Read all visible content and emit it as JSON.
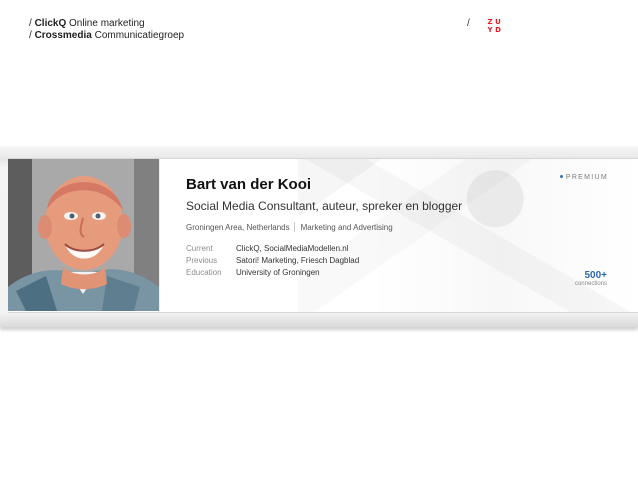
{
  "header": {
    "lines": [
      {
        "prefix": "/ ",
        "brand": "ClickQ",
        "rest": " Online marketing"
      },
      {
        "prefix": "/ ",
        "brand": "Crossmedia",
        "rest": " Communicatiegroep"
      }
    ],
    "slash": "/",
    "logo_text": [
      "Z",
      "U",
      "Y",
      "D"
    ]
  },
  "profile": {
    "name": "Bart van der Kooi",
    "headline": "Social Media Consultant, auteur, spreker en blogger",
    "location": "Groningen Area, Netherlands",
    "industry": "Marketing and Advertising",
    "badge": "PREMIUM",
    "details": [
      {
        "label": "Current",
        "value": "ClickQ, SocialMediaModellen.nl"
      },
      {
        "label": "Previous",
        "value": "Satori! Marketing, Friesch Dagblad"
      },
      {
        "label": "Education",
        "value": "University of Groningen"
      }
    ],
    "connections_count": "500+",
    "connections_label": "connections"
  },
  "colors": {
    "logo": "#e31b23",
    "premium_dot": "#2f75b5",
    "connections": "#2d69b0"
  },
  "icons": {
    "avatar": "profile-photo"
  }
}
